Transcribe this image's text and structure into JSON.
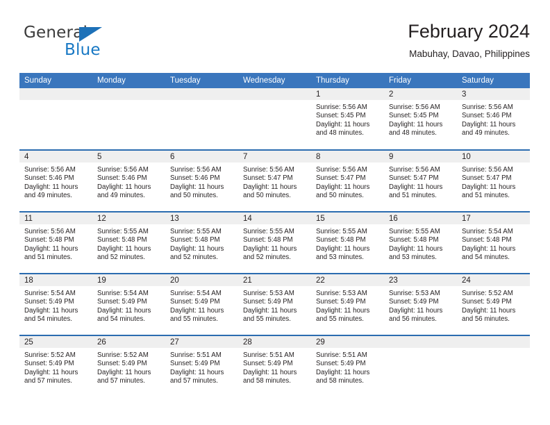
{
  "logo": {
    "word1": "General",
    "word2": "Blue",
    "triangle_color": "#1d71b8",
    "word1_color": "#3b3b3b",
    "word2_color": "#1878c4"
  },
  "header": {
    "title": "February 2024",
    "subtitle": "Mabuhay, Davao, Philippines"
  },
  "theme": {
    "header_bg": "#3a76bd",
    "header_text": "#ffffff",
    "row_border": "#2b6cb0",
    "daynum_bg": "#efefef",
    "body_text": "#231f20"
  },
  "calendar": {
    "weekday_headers": [
      "Sunday",
      "Monday",
      "Tuesday",
      "Wednesday",
      "Thursday",
      "Friday",
      "Saturday"
    ],
    "weeks": [
      [
        {
          "day": "",
          "lines": []
        },
        {
          "day": "",
          "lines": []
        },
        {
          "day": "",
          "lines": []
        },
        {
          "day": "",
          "lines": []
        },
        {
          "day": "1",
          "lines": [
            "Sunrise: 5:56 AM",
            "Sunset: 5:45 PM",
            "Daylight: 11 hours",
            "and 48 minutes."
          ]
        },
        {
          "day": "2",
          "lines": [
            "Sunrise: 5:56 AM",
            "Sunset: 5:45 PM",
            "Daylight: 11 hours",
            "and 48 minutes."
          ]
        },
        {
          "day": "3",
          "lines": [
            "Sunrise: 5:56 AM",
            "Sunset: 5:46 PM",
            "Daylight: 11 hours",
            "and 49 minutes."
          ]
        }
      ],
      [
        {
          "day": "4",
          "lines": [
            "Sunrise: 5:56 AM",
            "Sunset: 5:46 PM",
            "Daylight: 11 hours",
            "and 49 minutes."
          ]
        },
        {
          "day": "5",
          "lines": [
            "Sunrise: 5:56 AM",
            "Sunset: 5:46 PM",
            "Daylight: 11 hours",
            "and 49 minutes."
          ]
        },
        {
          "day": "6",
          "lines": [
            "Sunrise: 5:56 AM",
            "Sunset: 5:46 PM",
            "Daylight: 11 hours",
            "and 50 minutes."
          ]
        },
        {
          "day": "7",
          "lines": [
            "Sunrise: 5:56 AM",
            "Sunset: 5:47 PM",
            "Daylight: 11 hours",
            "and 50 minutes."
          ]
        },
        {
          "day": "8",
          "lines": [
            "Sunrise: 5:56 AM",
            "Sunset: 5:47 PM",
            "Daylight: 11 hours",
            "and 50 minutes."
          ]
        },
        {
          "day": "9",
          "lines": [
            "Sunrise: 5:56 AM",
            "Sunset: 5:47 PM",
            "Daylight: 11 hours",
            "and 51 minutes."
          ]
        },
        {
          "day": "10",
          "lines": [
            "Sunrise: 5:56 AM",
            "Sunset: 5:47 PM",
            "Daylight: 11 hours",
            "and 51 minutes."
          ]
        }
      ],
      [
        {
          "day": "11",
          "lines": [
            "Sunrise: 5:56 AM",
            "Sunset: 5:48 PM",
            "Daylight: 11 hours",
            "and 51 minutes."
          ]
        },
        {
          "day": "12",
          "lines": [
            "Sunrise: 5:55 AM",
            "Sunset: 5:48 PM",
            "Daylight: 11 hours",
            "and 52 minutes."
          ]
        },
        {
          "day": "13",
          "lines": [
            "Sunrise: 5:55 AM",
            "Sunset: 5:48 PM",
            "Daylight: 11 hours",
            "and 52 minutes."
          ]
        },
        {
          "day": "14",
          "lines": [
            "Sunrise: 5:55 AM",
            "Sunset: 5:48 PM",
            "Daylight: 11 hours",
            "and 52 minutes."
          ]
        },
        {
          "day": "15",
          "lines": [
            "Sunrise: 5:55 AM",
            "Sunset: 5:48 PM",
            "Daylight: 11 hours",
            "and 53 minutes."
          ]
        },
        {
          "day": "16",
          "lines": [
            "Sunrise: 5:55 AM",
            "Sunset: 5:48 PM",
            "Daylight: 11 hours",
            "and 53 minutes."
          ]
        },
        {
          "day": "17",
          "lines": [
            "Sunrise: 5:54 AM",
            "Sunset: 5:48 PM",
            "Daylight: 11 hours",
            "and 54 minutes."
          ]
        }
      ],
      [
        {
          "day": "18",
          "lines": [
            "Sunrise: 5:54 AM",
            "Sunset: 5:49 PM",
            "Daylight: 11 hours",
            "and 54 minutes."
          ]
        },
        {
          "day": "19",
          "lines": [
            "Sunrise: 5:54 AM",
            "Sunset: 5:49 PM",
            "Daylight: 11 hours",
            "and 54 minutes."
          ]
        },
        {
          "day": "20",
          "lines": [
            "Sunrise: 5:54 AM",
            "Sunset: 5:49 PM",
            "Daylight: 11 hours",
            "and 55 minutes."
          ]
        },
        {
          "day": "21",
          "lines": [
            "Sunrise: 5:53 AM",
            "Sunset: 5:49 PM",
            "Daylight: 11 hours",
            "and 55 minutes."
          ]
        },
        {
          "day": "22",
          "lines": [
            "Sunrise: 5:53 AM",
            "Sunset: 5:49 PM",
            "Daylight: 11 hours",
            "and 55 minutes."
          ]
        },
        {
          "day": "23",
          "lines": [
            "Sunrise: 5:53 AM",
            "Sunset: 5:49 PM",
            "Daylight: 11 hours",
            "and 56 minutes."
          ]
        },
        {
          "day": "24",
          "lines": [
            "Sunrise: 5:52 AM",
            "Sunset: 5:49 PM",
            "Daylight: 11 hours",
            "and 56 minutes."
          ]
        }
      ],
      [
        {
          "day": "25",
          "lines": [
            "Sunrise: 5:52 AM",
            "Sunset: 5:49 PM",
            "Daylight: 11 hours",
            "and 57 minutes."
          ]
        },
        {
          "day": "26",
          "lines": [
            "Sunrise: 5:52 AM",
            "Sunset: 5:49 PM",
            "Daylight: 11 hours",
            "and 57 minutes."
          ]
        },
        {
          "day": "27",
          "lines": [
            "Sunrise: 5:51 AM",
            "Sunset: 5:49 PM",
            "Daylight: 11 hours",
            "and 57 minutes."
          ]
        },
        {
          "day": "28",
          "lines": [
            "Sunrise: 5:51 AM",
            "Sunset: 5:49 PM",
            "Daylight: 11 hours",
            "and 58 minutes."
          ]
        },
        {
          "day": "29",
          "lines": [
            "Sunrise: 5:51 AM",
            "Sunset: 5:49 PM",
            "Daylight: 11 hours",
            "and 58 minutes."
          ]
        },
        {
          "day": "",
          "lines": []
        },
        {
          "day": "",
          "lines": []
        }
      ]
    ]
  }
}
